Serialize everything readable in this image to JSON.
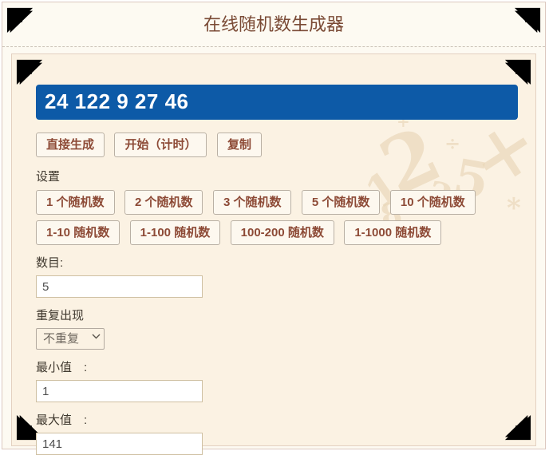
{
  "page": {
    "title": "在线随机数生成器"
  },
  "result": {
    "value": "24 122 9 27 46"
  },
  "actions": [
    "直接生成",
    "开始（计时）",
    "复制"
  ],
  "settings": {
    "heading": "设置",
    "count_presets": [
      "1 个随机数",
      "2 个随机数",
      "3 个随机数",
      "5 个随机数",
      "10 个随机数"
    ],
    "range_presets": [
      "1-10 随机数",
      "1-100 随机数",
      "100-200 随机数",
      "1-1000 随机数"
    ],
    "count_label": "数目:",
    "count_value": "5",
    "repeat_label": "重复出现",
    "repeat_value": "不重复",
    "min_label": "最小值　:",
    "min_value": "1",
    "max_label": "最大值　:",
    "max_value": "141"
  },
  "colors": {
    "accent_blue": "#0d5aa7",
    "button_text": "#8d4a36",
    "title_text": "#7a4a35",
    "panel_background": "#fbf2e3"
  },
  "watermark": {
    "glyphs": [
      "1",
      "2",
      "+",
      "÷",
      "5",
      "7",
      "×",
      "2",
      "8",
      "*"
    ]
  }
}
